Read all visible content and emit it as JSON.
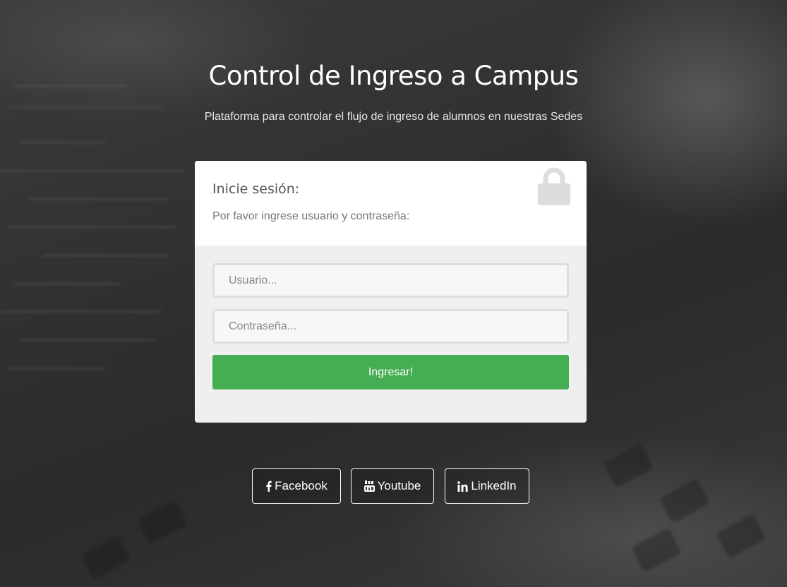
{
  "header": {
    "title": "Control de Ingreso a Campus",
    "subtitle": "Plataforma para controlar el flujo de ingreso de alumnos en nuestras Sedes"
  },
  "login": {
    "heading": "Inicie sesión:",
    "description": "Por favor ingrese usuario y contraseña:",
    "icon": "lock-icon",
    "username": {
      "value": "",
      "placeholder": "Usuario..."
    },
    "password": {
      "value": "",
      "placeholder": "Contraseña..."
    },
    "submit_label": "Ingresar!",
    "colors": {
      "submit": "#46ae52",
      "card_body": "#efefef",
      "lock": "#dddddd"
    }
  },
  "social": [
    {
      "label": "Facebook",
      "icon": "facebook-icon"
    },
    {
      "label": "Youtube",
      "icon": "youtube-icon"
    },
    {
      "label": "LinkedIn",
      "icon": "linkedin-icon"
    }
  ]
}
